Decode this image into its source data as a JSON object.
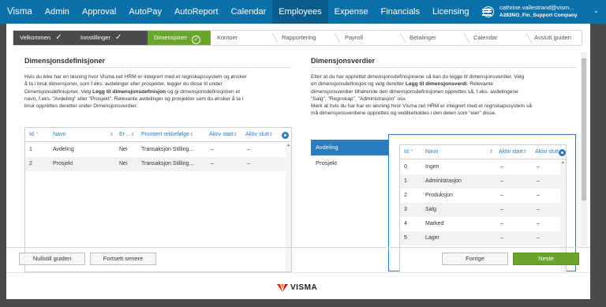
{
  "topnav": {
    "brand": "Visma",
    "items": [
      "Admin",
      "Approval",
      "AutoPay",
      "AutoReport",
      "Calendar",
      "Employees",
      "Expense",
      "Financials",
      "Licensing"
    ],
    "active": "Employees",
    "help_icon": "?",
    "user_email": "cathrine.vallestrand@vism...",
    "user_company": "A283NO_Fin_Support Company"
  },
  "steps": [
    {
      "label": "Velkommen",
      "state": "done"
    },
    {
      "label": "Innstillinger",
      "state": "done"
    },
    {
      "label": "Dimensjoner",
      "state": "current"
    },
    {
      "label": "Kontoer",
      "state": "pending"
    },
    {
      "label": "Rapportering",
      "state": "pending"
    },
    {
      "label": "Payroll",
      "state": "pending"
    },
    {
      "label": "Betalinger",
      "state": "pending"
    },
    {
      "label": "Calendar",
      "state": "pending"
    },
    {
      "label": "Avslutt guiden",
      "state": "pending"
    }
  ],
  "left": {
    "title": "Dimensjonsdefinisjoner",
    "p1": "Hvis du ikke har en løsning hvor Visma.net HRM er integrert med et regnskapssystem og ønsker",
    "p2": "å ta i bruk dimensjoner, som f.eks. avdelinger eller prosjekter, legger du disse til under",
    "p3a": "Dimensjonsdefinisjoner. Velg ",
    "p3b": "Legg til dimensjonsdefinisjon",
    "p3c": " og gi dimensjonsdefinisjonen et",
    "p4": "navn, f.eks. \"Avdeling\" eller \"Prosjekt\". Relevante avdelinger og prosjekter som du ønsker å ta i",
    "p5": "bruk opprettes deretter under Dimensjonsverdier.",
    "columns": [
      "Id",
      "Navn",
      "Er ...",
      "Prioritert rekkefølge",
      "Aktiv start",
      "Aktiv slutt"
    ],
    "rows": [
      [
        "1",
        "Avdeling",
        "Nei",
        "Transaksjon Stilling...",
        "–",
        "–"
      ],
      [
        "2",
        "Prosjekt",
        "Nei",
        "Transaksjon Stilling...",
        "–",
        "–"
      ]
    ]
  },
  "right": {
    "title": "Dimensjonsverdier",
    "p1": "Etter at du har opprettet dimensjonsdefinisjonene så kan du legge til dimensjonsverdier. Velg",
    "p2a": "en dimensjonsdefinisjon og velg deretter ",
    "p2b": "Legg til dimensjonsverdi",
    "p2c": ". Relevante",
    "p3": "dimensjonsverdier tilhørende den dimensjonsdefinisjonen opprettes så, f.eks. avdelingene",
    "p4": "\"Salg\", \"Regnskap\", \"Administrasjon\" osv.",
    "p5": "Merk at hvis du har har en løsning hvor Visma.net HRM er integrert med et regnskapssystem så",
    "p6": "må dimensjonsverdiene opprettes og vedlikeholdes i den delen som \"eier\" disse.",
    "dimensions": [
      "Avdeling",
      "Prosjekt"
    ],
    "selected_dimension": "Avdeling",
    "columns": [
      "Id",
      "Navn",
      "Aktiv start",
      "Aktiv slutt"
    ],
    "rows": [
      [
        "0",
        "Ingen",
        "–",
        "–"
      ],
      [
        "1",
        "Administrasjon",
        "–",
        "–"
      ],
      [
        "2",
        "Produksjon",
        "–",
        "–"
      ],
      [
        "3",
        "Salg",
        "–",
        "–"
      ],
      [
        "4",
        "Marked",
        "–",
        "–"
      ],
      [
        "5",
        "Lager",
        "–",
        "–"
      ]
    ]
  },
  "footer": {
    "reset": "Nullstill guiden",
    "later": "Fortsett senere",
    "prev": "Forrige",
    "next": "Neste"
  },
  "logo_text": "VISMA",
  "colors": {
    "nav": "#0b6fa8",
    "nav_active": "#0a5c8c",
    "accent_green": "#6aa42b",
    "step_done": "#4a4a4a",
    "link_blue": "#2b7bbf"
  }
}
